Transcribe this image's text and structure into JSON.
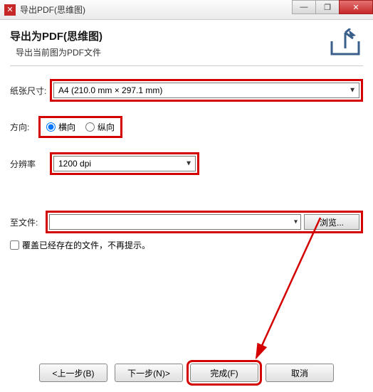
{
  "window": {
    "title": "导出PDF(思维图)"
  },
  "header": {
    "title": "导出为PDF(思维图)",
    "subtitle": "导出当前图为PDF文件"
  },
  "form": {
    "paper_label": "纸张尺寸:",
    "paper_value": "A4 (210.0 mm × 297.1 mm)",
    "orientation_label": "方向:",
    "orientation_landscape": "横向",
    "orientation_portrait": "纵向",
    "resolution_label": "分辨率",
    "resolution_value": "1200 dpi",
    "tofile_label": "至文件:",
    "tofile_value": "",
    "browse_label": "浏览...",
    "overwrite_label": "覆盖已经存在的文件，不再提示。"
  },
  "footer": {
    "back": "<上一步(B)",
    "next": "下一步(N)>",
    "finish": "完成(F)",
    "cancel": "取消"
  },
  "icons": {
    "app": "✕",
    "minimize": "—",
    "maximize": "❐",
    "close": "✕"
  }
}
